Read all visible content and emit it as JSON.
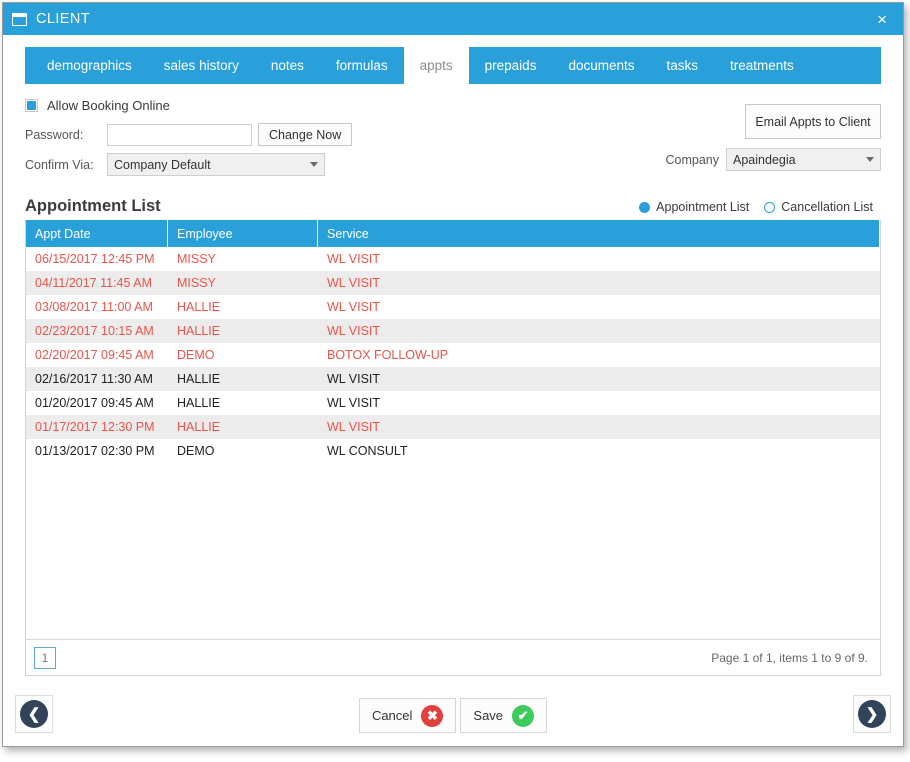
{
  "window": {
    "title": "CLIENT",
    "icon": "window-icon",
    "close_label": "×"
  },
  "tabs": [
    {
      "label": "demographics",
      "active": false
    },
    {
      "label": "sales history",
      "active": false
    },
    {
      "label": "notes",
      "active": false
    },
    {
      "label": "formulas",
      "active": false
    },
    {
      "label": "appts",
      "active": true
    },
    {
      "label": "prepaids",
      "active": false
    },
    {
      "label": "documents",
      "active": false
    },
    {
      "label": "tasks",
      "active": false
    },
    {
      "label": "treatments",
      "active": false
    }
  ],
  "form": {
    "allow_booking_label": "Allow Booking Online",
    "allow_booking_checked": true,
    "password_label": "Password:",
    "password_value": "",
    "password_placeholder": "",
    "change_now_label": "Change Now",
    "confirm_via_label": "Confirm Via:",
    "confirm_via_value": "Company Default",
    "email_appts_label": "Email Appts to Client",
    "company_label": "Company",
    "company_value": "Apaindegia"
  },
  "list_section": {
    "title": "Appointment List",
    "radios": [
      {
        "label": "Appointment List",
        "checked": true
      },
      {
        "label": "Cancellation List",
        "checked": false
      }
    ]
  },
  "grid": {
    "columns": [
      "Appt Date",
      "Employee",
      "Service"
    ],
    "rows": [
      {
        "cells": [
          "06/15/2017 12:45 PM",
          "MISSY",
          "WL VISIT"
        ],
        "highlight": true
      },
      {
        "cells": [
          "04/11/2017 11:45 AM",
          "MISSY",
          "WL VISIT"
        ],
        "highlight": true
      },
      {
        "cells": [
          "03/08/2017 11:00 AM",
          "HALLIE",
          "WL VISIT"
        ],
        "highlight": true
      },
      {
        "cells": [
          "02/23/2017 10:15 AM",
          "HALLIE",
          "WL VISIT"
        ],
        "highlight": true
      },
      {
        "cells": [
          "02/20/2017 09:45 AM",
          "DEMO",
          "BOTOX FOLLOW-UP"
        ],
        "highlight": true
      },
      {
        "cells": [
          "02/16/2017 11:30 AM",
          "HALLIE",
          "WL VISIT"
        ],
        "highlight": false
      },
      {
        "cells": [
          "01/20/2017 09:45 AM",
          "HALLIE",
          "WL VISIT"
        ],
        "highlight": false
      },
      {
        "cells": [
          "01/17/2017 12:30 PM",
          "HALLIE",
          "WL VISIT"
        ],
        "highlight": true
      },
      {
        "cells": [
          "01/13/2017 02:30 PM",
          "DEMO",
          "WL CONSULT"
        ],
        "highlight": false
      }
    ],
    "footer": {
      "page_number": "1",
      "page_info": "Page 1 of 1, items 1 to 9 of 9."
    }
  },
  "footer": {
    "prev_label": "❮",
    "next_label": "❯",
    "cancel_label": "Cancel",
    "cancel_icon": "✖",
    "save_label": "Save",
    "save_icon": "✔"
  },
  "colors": {
    "accent_blue": "#29a0da",
    "row_alt": "#ececec",
    "highlight_red": "#e8554a",
    "cancel_red": "#e2403a",
    "save_green": "#3dcc5c",
    "nav_navy": "#31445a"
  }
}
